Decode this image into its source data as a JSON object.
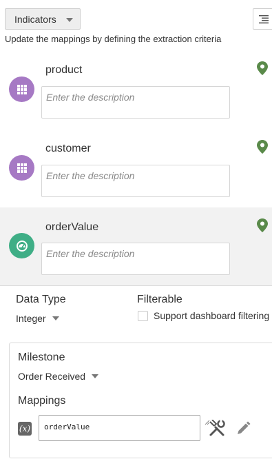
{
  "header": {
    "dropdown_label": "Indicators",
    "subtitle": "Update the mappings by defining the extraction criteria"
  },
  "indicators": [
    {
      "name": "product",
      "description_placeholder": "Enter the description",
      "icon": "grid-icon",
      "icon_color": "#a679c4"
    },
    {
      "name": "customer",
      "description_placeholder": "Enter the description",
      "icon": "grid-icon",
      "icon_color": "#a679c4"
    },
    {
      "name": "orderValue",
      "description_placeholder": "Enter the description",
      "icon": "gauge-icon",
      "icon_color": "#3fae86"
    }
  ],
  "details": {
    "data_type_label": "Data Type",
    "data_type_value": "Integer",
    "filterable_label": "Filterable",
    "filterable_option": "Support dashboard filtering",
    "milestone_label": "Milestone",
    "milestone_value": "Order Received",
    "mappings_label": "Mappings",
    "mapping_value": "orderValue",
    "fx_symbol": "(x)"
  },
  "colors": {
    "pin": "#5a8a4a",
    "selected_row": "#f2f2f2"
  }
}
